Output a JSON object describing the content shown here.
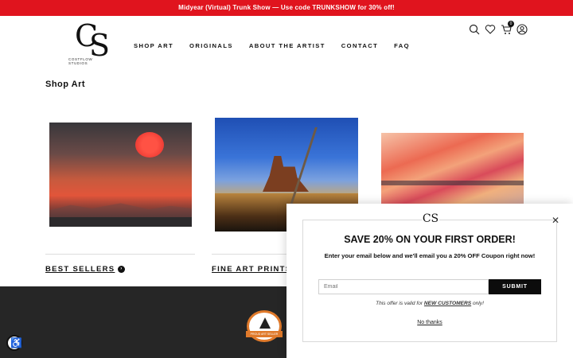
{
  "announcement": "Midyear (Virtual) Trunk Show — Use code TRUNKSHOW for 30% off!",
  "logo": {
    "mono": "C",
    "mono2": "S",
    "sub": "COSTFLOW STUDIOS"
  },
  "nav": [
    "SHOP ART",
    "ORIGINALS",
    "ABOUT THE ARTIST",
    "CONTACT",
    "FAQ"
  ],
  "header_icons": [
    "search-icon",
    "heart-icon",
    "cart-icon",
    "account-icon"
  ],
  "cart_count": "0",
  "page_title": "Shop Art",
  "categories": [
    {
      "label": "BEST SELLERS"
    },
    {
      "label": "FINE ART PRINTS"
    }
  ],
  "popup": {
    "logo": "CS",
    "close": "✕",
    "title": "SAVE 20% ON YOUR FIRST ORDER!",
    "text": "Enter your email below and we'll email you a 20% OFF Coupon right now!",
    "email_placeholder": "Email",
    "submit": "SUBMIT",
    "note_prefix": "This offer is valid for ",
    "note_link": "NEW CUSTOMERS",
    "note_suffix": " only!",
    "no_thanks": "No thanks"
  },
  "footer_badge": "PROUD ART SELLER",
  "colors": {
    "announcement_bg": "#e0141e",
    "footer_bg": "#262626",
    "badge": "#e07a2b"
  }
}
